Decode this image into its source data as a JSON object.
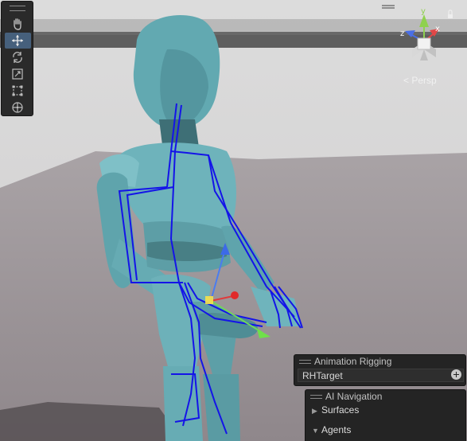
{
  "viewport": {
    "camera_label": "Persp",
    "gizmo_axes": {
      "x": "x",
      "y": "y",
      "z": "z"
    },
    "colors": {
      "sky": "#d6d6d6",
      "ground": "#9a9396",
      "character": "#5fa6ae",
      "skeleton": "#1010e6"
    }
  },
  "tools": [
    {
      "name": "hand-tool",
      "active": false
    },
    {
      "name": "move-tool",
      "active": true
    },
    {
      "name": "rotate-tool",
      "active": false
    },
    {
      "name": "scale-tool",
      "active": false
    },
    {
      "name": "rect-tool",
      "active": false
    },
    {
      "name": "transform-tool",
      "active": false
    }
  ],
  "animation_rigging": {
    "title": "Animation Rigging",
    "field_value": "RHTarget"
  },
  "ai_navigation": {
    "title": "AI Navigation",
    "items": [
      {
        "label": "Surfaces",
        "expanded": false
      },
      {
        "label": "Agents",
        "expanded": true
      }
    ]
  }
}
